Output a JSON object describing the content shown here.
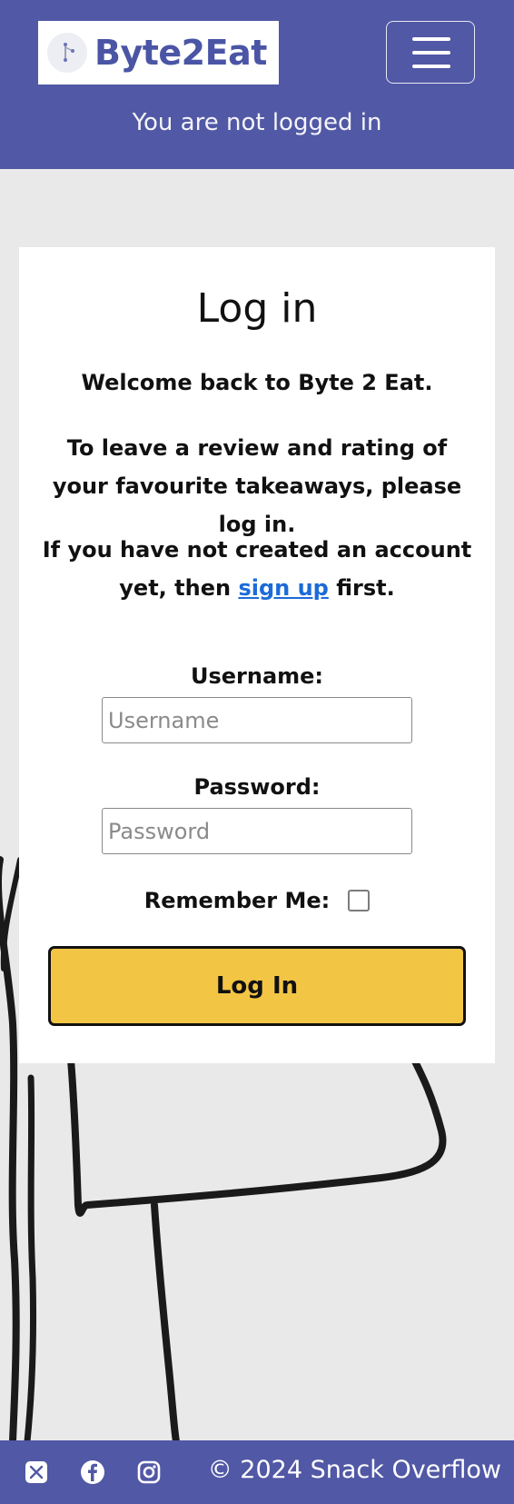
{
  "header": {
    "brand_name": "Byte2Eat",
    "status_text": "You are not logged in",
    "logo_icon": "byte2eat-logo-icon",
    "menu_icon": "hamburger-menu-icon"
  },
  "login": {
    "title": "Log in",
    "welcome": "Welcome back to Byte 2 Eat.",
    "instruction": "To leave a review and rating of your favourite takeaways, please log in.",
    "signup_prefix": "If you have not created an account yet, then",
    "signup_link": "sign up",
    "signup_suffix": "first.",
    "username_label": "Username:",
    "username_placeholder": "Username",
    "username_value": "",
    "password_label": "Password:",
    "password_placeholder": "Password",
    "password_value": "",
    "remember_label": "Remember Me:",
    "remember_checked": false,
    "submit_label": "Log In"
  },
  "footer": {
    "social_icons": [
      "x-twitter-icon",
      "facebook-icon",
      "instagram-icon"
    ],
    "copyright": "© 2024 Snack Overflow"
  },
  "colors": {
    "brand": "#5158a5",
    "button": "#f3c545",
    "link": "#1b6bd8",
    "background": "#e9e9e9"
  }
}
